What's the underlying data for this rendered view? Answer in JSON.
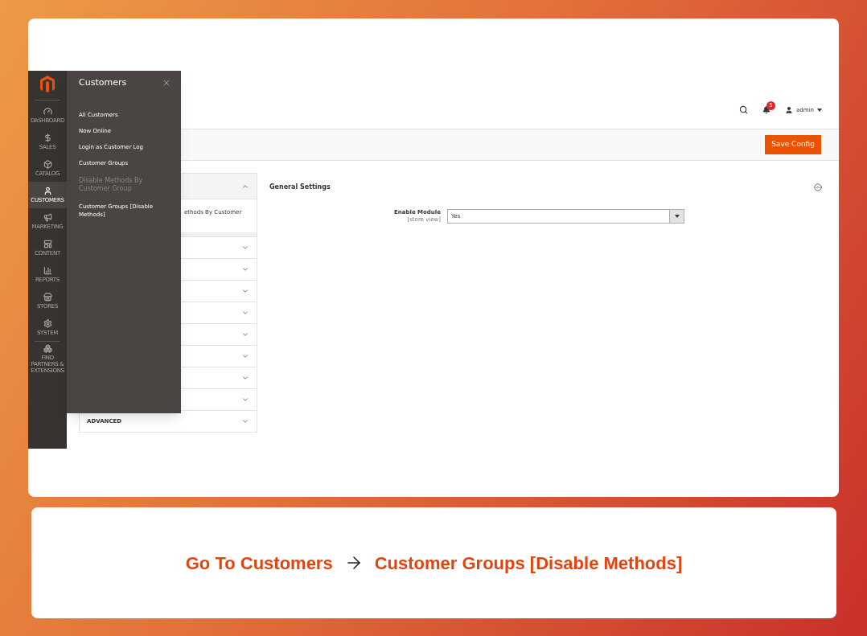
{
  "sidebar": {
    "items": [
      {
        "label": "DASHBOARD",
        "selected": false
      },
      {
        "label": "SALES",
        "selected": false
      },
      {
        "label": "CATALOG",
        "selected": false
      },
      {
        "label": "CUSTOMERS",
        "selected": true
      },
      {
        "label": "MARKETING",
        "selected": false
      },
      {
        "label": "CONTENT",
        "selected": false
      },
      {
        "label": "REPORTS",
        "selected": false
      },
      {
        "label": "STORES",
        "selected": false
      },
      {
        "label": "SYSTEM",
        "selected": false
      },
      {
        "label": "FIND PARTNERS & EXTENSIONS",
        "selected": false
      }
    ]
  },
  "flyout": {
    "title": "Customers",
    "items": [
      {
        "label": "All Customers",
        "disabled": false
      },
      {
        "label": "Now Online",
        "disabled": false
      },
      {
        "label": "Login as Customer Log",
        "disabled": false
      },
      {
        "label": "Customer Groups",
        "disabled": false
      },
      {
        "label": "Disable Methods By Customer Group",
        "disabled": true
      },
      {
        "label": "Customer Groups [Disable Methods]",
        "disabled": false
      }
    ]
  },
  "header": {
    "notifications": "5",
    "user": "admin"
  },
  "save_button": "Save Config",
  "config_sections": [
    {
      "expanded": true,
      "items": [
        "ethods By Customer"
      ]
    },
    {
      "expanded": false
    },
    {
      "expanded": false
    },
    {
      "expanded": false
    },
    {
      "expanded": false
    },
    {
      "expanded": false
    },
    {
      "expanded": false
    },
    {
      "expanded": false
    },
    {
      "expanded": false
    },
    {
      "label": "ADVANCED",
      "expanded": false
    }
  ],
  "general_settings": {
    "title": "General Settings",
    "expanded": true,
    "fields": [
      {
        "label": "Enable Module",
        "scope": "[store view]",
        "value": "Yes"
      }
    ]
  },
  "caption": {
    "from": "Go To Customers",
    "to": "Customer Groups [Disable Methods]"
  }
}
